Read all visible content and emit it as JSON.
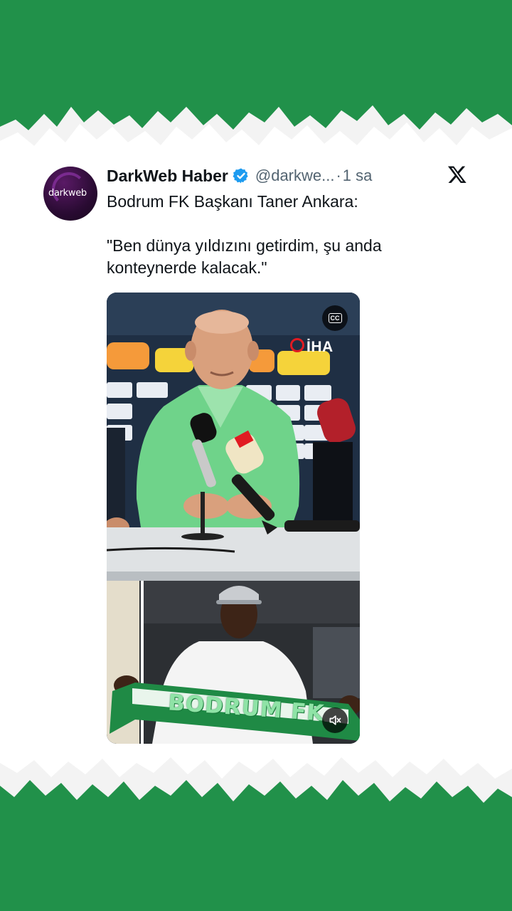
{
  "tweet": {
    "author_name": "DarkWeb Haber",
    "handle": "@darkwe...",
    "separator": " · ",
    "time": "1 sa",
    "avatar_text": "darkweb",
    "text_line1": "Bodrum FK Başkanı Taner Ankara:",
    "text_quote": "\"Ben dünya yıldızını getirdim, şu anda\nkonteynerde kalacak.\""
  },
  "icons": {
    "verified": "verified-badge-icon",
    "x_logo": "x-logo-icon",
    "cc": "closed-captions-icon",
    "mute": "speaker-muted-icon"
  },
  "media": {
    "cc_label": "CC",
    "news_agency": "İHA",
    "scarf_text": "BODRUM FK"
  },
  "colors": {
    "background_green": "#21914a",
    "paper": "#ffffff",
    "verified_blue": "#1d9bf0",
    "shirt_green": "#6fd38a"
  }
}
